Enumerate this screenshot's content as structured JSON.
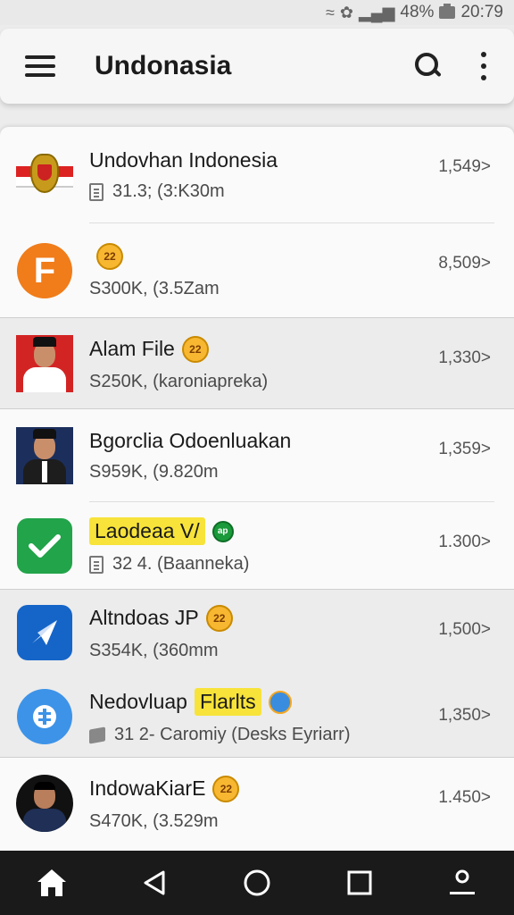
{
  "status_bar": {
    "battery": "48%",
    "time": "20:79"
  },
  "app_bar": {
    "title": "Undonasia"
  },
  "items": [
    {
      "title": "Undovhan Indonesia",
      "sub": "31.3; (3:K30m",
      "count": "1,549>"
    },
    {
      "title": "",
      "sub": "S300K, (3.5Zam",
      "count": "8,509>",
      "emoji": "22"
    },
    {
      "title": "Alam File",
      "sub": "S250K, (karoniapreka)",
      "count": "1,330>",
      "emoji": "22"
    },
    {
      "title": "Bgorclia Odoenluakan",
      "sub": "S959K, (9.820m",
      "count": "1,359>"
    },
    {
      "title": "Laodeaa V/",
      "sub": "32 4. (Baanneka)",
      "count": "1.300>",
      "emoji": "ap"
    },
    {
      "title": "Altndoas JP",
      "sub": "S354K, (360mm",
      "count": "1,500>",
      "emoji": "22"
    },
    {
      "title": "Nedovluap",
      "highlight": "Flarlts",
      "sub": "31 2- Caromiy (Desks Eyriarr)",
      "count": "1,350>"
    },
    {
      "title": "IndowaKiarE",
      "sub": "S470K, (3.529m",
      "count": "1.450>",
      "emoji": "22"
    }
  ],
  "colors": {
    "accent_orange": "#f07c1a",
    "accent_green": "#22a44a",
    "accent_blue": "#1565c8",
    "navbar": "#1a1a1a"
  }
}
